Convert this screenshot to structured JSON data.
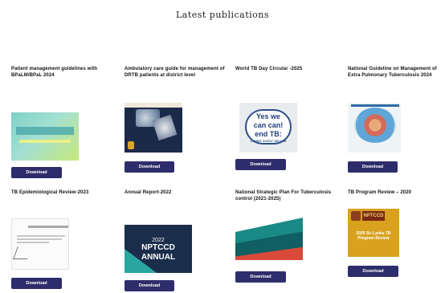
{
  "page": {
    "heading": "Latest publications"
  },
  "publications": [
    {
      "title": "Patient management guidelines with BPaLM/BPaL 2024",
      "download": "Download"
    },
    {
      "title": "Ambulatory care guide for management of DRTB patients at district level",
      "download": "Download"
    },
    {
      "title": "World TB Day Circular -2025",
      "download": "Download",
      "thumb": {
        "line1": "Yes we",
        "line2": "can can!",
        "line3": "end TB:",
        "line4": "COMMIT. INVEST. DELIVER"
      }
    },
    {
      "title": "National Guideline on Management of Extra Pulmonary Tuberculosis 2024",
      "download": "Download"
    },
    {
      "title": "TB Epidemiological Review-2023",
      "download": "Download"
    },
    {
      "title": "Annual Report-2022",
      "download": "Download",
      "thumb": {
        "year": "2022",
        "name": "NPTCCD",
        "label": "ANNUAL"
      }
    },
    {
      "title": "National Strategic Plan For Tuberculosis control (2021-2025)",
      "download": "Download"
    },
    {
      "title": "TB Program Review – 2020",
      "download": "Download",
      "thumb": {
        "badge": "NPTCCD",
        "text": "2020 Sri Lanka TB Program Review"
      }
    }
  ],
  "colors": {
    "button": "#2e2d6b",
    "button_text": "#ffffff"
  }
}
